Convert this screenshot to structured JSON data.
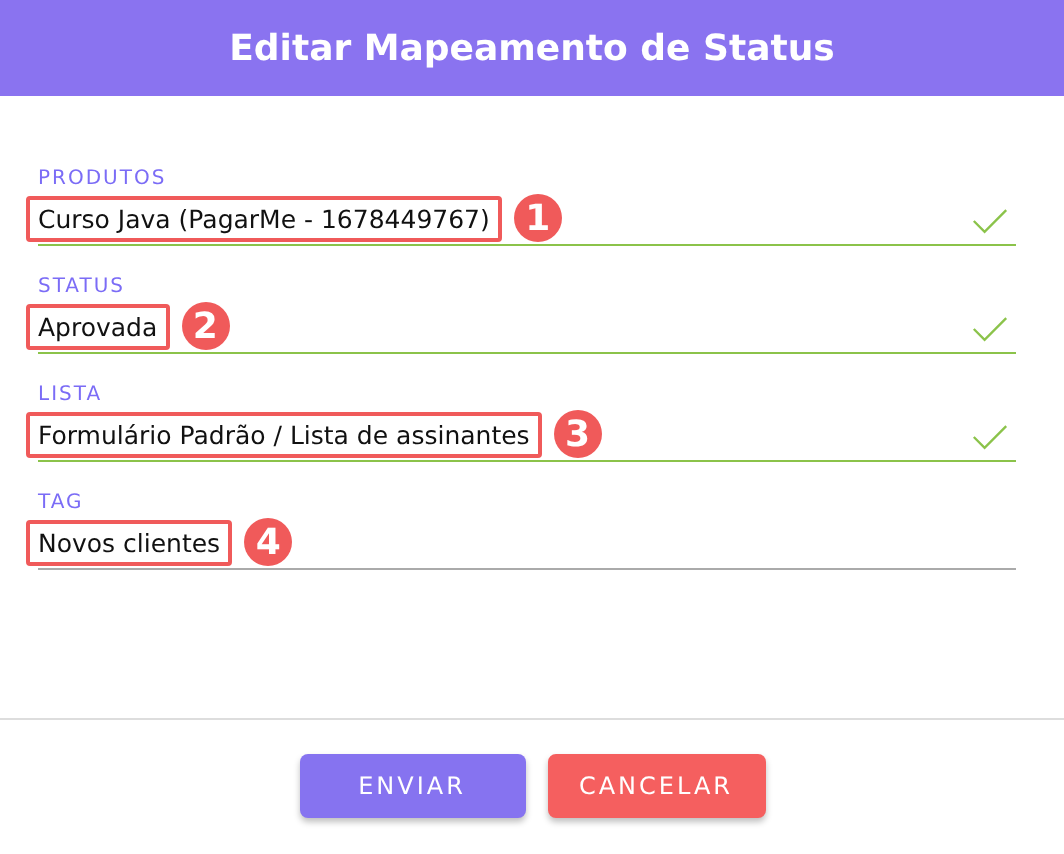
{
  "dialog": {
    "title": "Editar Mapeamento de Status"
  },
  "fields": [
    {
      "label": "PRODUTOS",
      "value": "Curso Java (PagarMe - 1678449767)",
      "valid": true,
      "callout": "1"
    },
    {
      "label": "STATUS",
      "value": "Aprovada",
      "valid": true,
      "callout": "2"
    },
    {
      "label": "LISTA",
      "value": "Formulário Padrão / Lista de assinantes",
      "valid": true,
      "callout": "3"
    },
    {
      "label": "TAG",
      "value": "Novos clientes",
      "valid": false,
      "callout": "4"
    }
  ],
  "buttons": [
    {
      "label": "ENVIAR",
      "kind": "primary"
    },
    {
      "label": "CANCELAR",
      "kind": "danger"
    }
  ]
}
